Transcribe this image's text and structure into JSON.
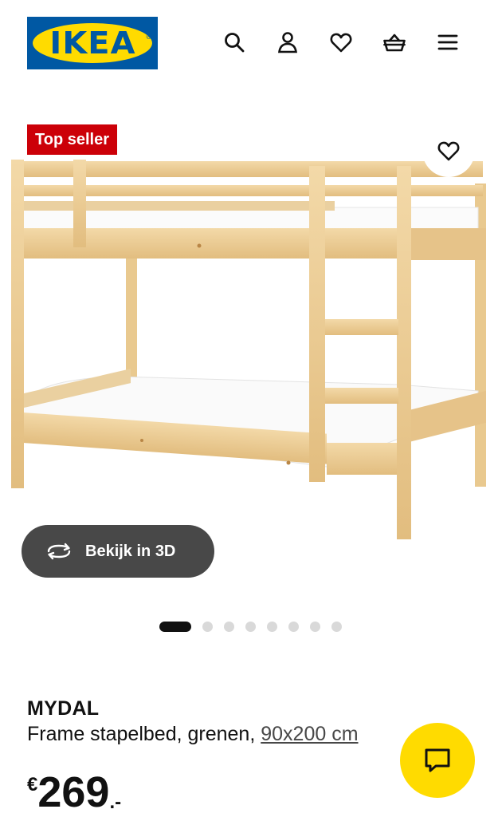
{
  "header": {
    "logo_text": "IKEA",
    "logo_mark": "®",
    "icons": [
      "search-icon",
      "user-icon",
      "heart-icon",
      "basket-icon",
      "menu-icon"
    ]
  },
  "product_image": {
    "badge": "Top seller",
    "view_3d_label": "Bekijk in 3D",
    "carousel": {
      "total": 8,
      "active": 1
    }
  },
  "product": {
    "name": "MYDAL",
    "description": "Frame stapelbed, grenen, ",
    "size": "90x200 cm",
    "price_currency": "€",
    "price_amount": "269",
    "price_suffix": ".-"
  },
  "colors": {
    "brand_blue": "#0058a3",
    "brand_yellow": "#ffdb00",
    "badge_red": "#cc0008",
    "button_dark": "#484848"
  }
}
